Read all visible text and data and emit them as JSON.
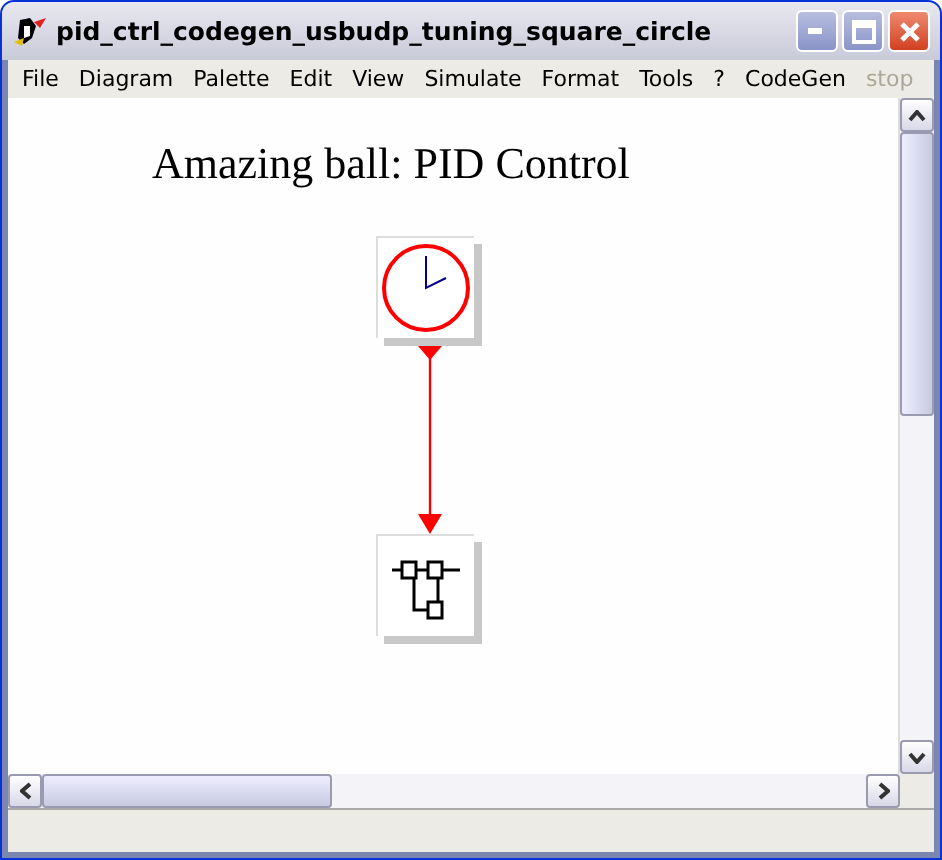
{
  "window": {
    "title": "pid_ctrl_codegen_usbudp_tuning_square_circle"
  },
  "menu": [
    {
      "label": "File",
      "disabled": false
    },
    {
      "label": "Diagram",
      "disabled": false
    },
    {
      "label": "Palette",
      "disabled": false
    },
    {
      "label": "Edit",
      "disabled": false
    },
    {
      "label": "View",
      "disabled": false
    },
    {
      "label": "Simulate",
      "disabled": false
    },
    {
      "label": "Format",
      "disabled": false
    },
    {
      "label": "Tools",
      "disabled": false
    },
    {
      "label": "?",
      "disabled": false
    },
    {
      "label": "CodeGen",
      "disabled": false
    },
    {
      "label": "stop",
      "disabled": true
    }
  ],
  "diagram": {
    "title": "Amazing ball: PID Control",
    "blocks": [
      {
        "kind": "clock"
      },
      {
        "kind": "pid"
      }
    ]
  }
}
